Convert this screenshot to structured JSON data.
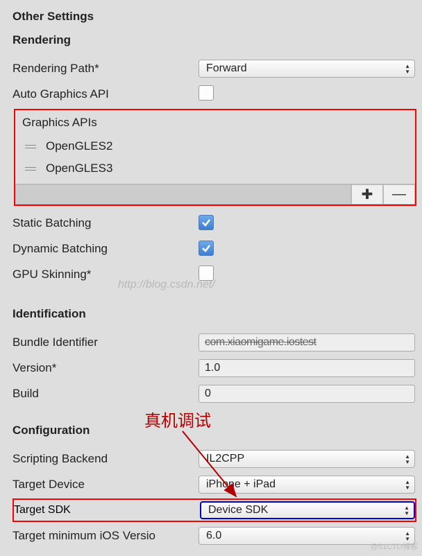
{
  "headers": {
    "otherSettings": "Other Settings",
    "rendering": "Rendering",
    "identification": "Identification",
    "configuration": "Configuration"
  },
  "rendering": {
    "path_label": "Rendering Path*",
    "path_value": "Forward",
    "auto_label": "Auto Graphics API",
    "graphics_title": "Graphics APIs",
    "apis": [
      "OpenGLES2",
      "OpenGLES3"
    ],
    "static_label": "Static Batching",
    "dynamic_label": "Dynamic Batching",
    "gpu_label": "GPU Skinning*"
  },
  "identification": {
    "bundle_label": "Bundle Identifier",
    "bundle_value": "com.xiaomigame.iostest",
    "version_label": "Version*",
    "version_value": "1.0",
    "build_label": "Build",
    "build_value": "0"
  },
  "configuration": {
    "scripting_label": "Scripting Backend",
    "scripting_value": "IL2CPP",
    "device_label": "Target Device",
    "device_value": "iPhone + iPad",
    "sdk_label": "Target SDK",
    "sdk_value": "Device SDK",
    "minios_label": "Target minimum iOS Versio",
    "minios_value": "6.0"
  },
  "annotation": "真机调试",
  "watermark": "http://blog.csdn.net/",
  "corner": "@51CTO博客"
}
